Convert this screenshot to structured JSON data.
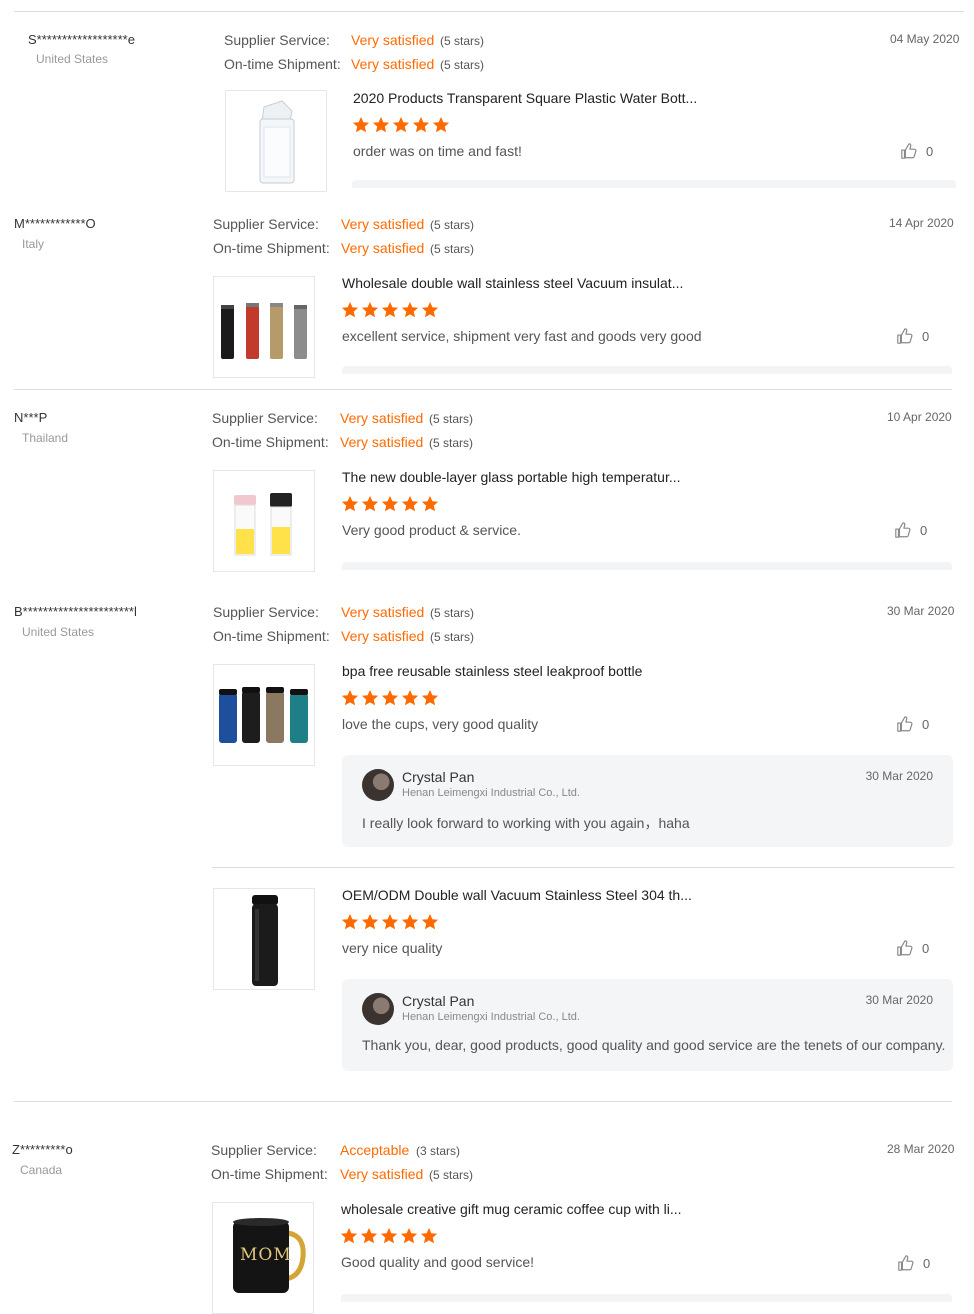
{
  "labels": {
    "supplier_service": "Supplier Service:",
    "ontime_shipment": "On-time Shipment:"
  },
  "reviews": [
    {
      "buyer": "S******************e",
      "country": "United States",
      "date": "04 May 2020",
      "supplier_rating": "Very satisfied",
      "supplier_stars": "(5 stars)",
      "shipment_rating": "Very satisfied",
      "shipment_stars": "(5 stars)",
      "products": [
        {
          "title": "2020 Products Transparent Square Plastic Water Bott...",
          "rating": 5,
          "comment": "order was on time and fast!",
          "likes": "0"
        }
      ]
    },
    {
      "buyer": "M************O",
      "country": "Italy",
      "date": "14 Apr 2020",
      "supplier_rating": "Very satisfied",
      "supplier_stars": "(5 stars)",
      "shipment_rating": "Very satisfied",
      "shipment_stars": "(5 stars)",
      "products": [
        {
          "title": "Wholesale double wall stainless steel Vacuum insulat...",
          "rating": 5,
          "comment": "excellent service, shipment very fast and goods very good",
          "likes": "0"
        }
      ]
    },
    {
      "buyer": "N***P",
      "country": "Thailand",
      "date": "10 Apr 2020",
      "supplier_rating": "Very satisfied",
      "supplier_stars": "(5 stars)",
      "shipment_rating": "Very satisfied",
      "shipment_stars": "(5 stars)",
      "products": [
        {
          "title": "The new double-layer glass portable high temperatur...",
          "rating": 5,
          "comment": "Very good product & service.",
          "likes": "0"
        }
      ]
    },
    {
      "buyer": "B**********************l",
      "country": "United States",
      "date": "30 Mar 2020",
      "supplier_rating": "Very satisfied",
      "supplier_stars": "(5 stars)",
      "shipment_rating": "Very satisfied",
      "shipment_stars": "(5 stars)",
      "products": [
        {
          "title": "bpa free reusable stainless steel leakproof bottle",
          "rating": 5,
          "comment": "love the cups, very good quality",
          "likes": "0",
          "reply": {
            "name": "Crystal Pan",
            "company": "Henan Leimengxi Industrial Co., Ltd.",
            "date": "30 Mar 2020",
            "text": "I really look forward to working with you again，haha"
          }
        },
        {
          "title": "OEM/ODM Double wall Vacuum Stainless Steel 304 th...",
          "rating": 5,
          "comment": "very nice quality",
          "likes": "0",
          "reply": {
            "name": "Crystal Pan",
            "company": "Henan Leimengxi Industrial Co., Ltd.",
            "date": "30 Mar 2020",
            "text": "Thank you, dear, good products, good quality and good service are the tenets of our company."
          }
        }
      ]
    },
    {
      "buyer": "Z*********o",
      "country": "Canada",
      "date": "28 Mar 2020",
      "supplier_rating": "Acceptable",
      "supplier_stars": "(3 stars)",
      "shipment_rating": "Very satisfied",
      "shipment_stars": "(5 stars)",
      "products": [
        {
          "title": "wholesale creative gift mug ceramic coffee cup with li...",
          "rating": 5,
          "comment": "Good quality and good service!",
          "likes": "0",
          "image_text": "MOM"
        }
      ]
    }
  ],
  "colors": {
    "accent": "#ff6a00",
    "star": "#ff6a00"
  },
  "icons": {
    "star": "star-icon",
    "like": "thumbs-up-icon"
  }
}
